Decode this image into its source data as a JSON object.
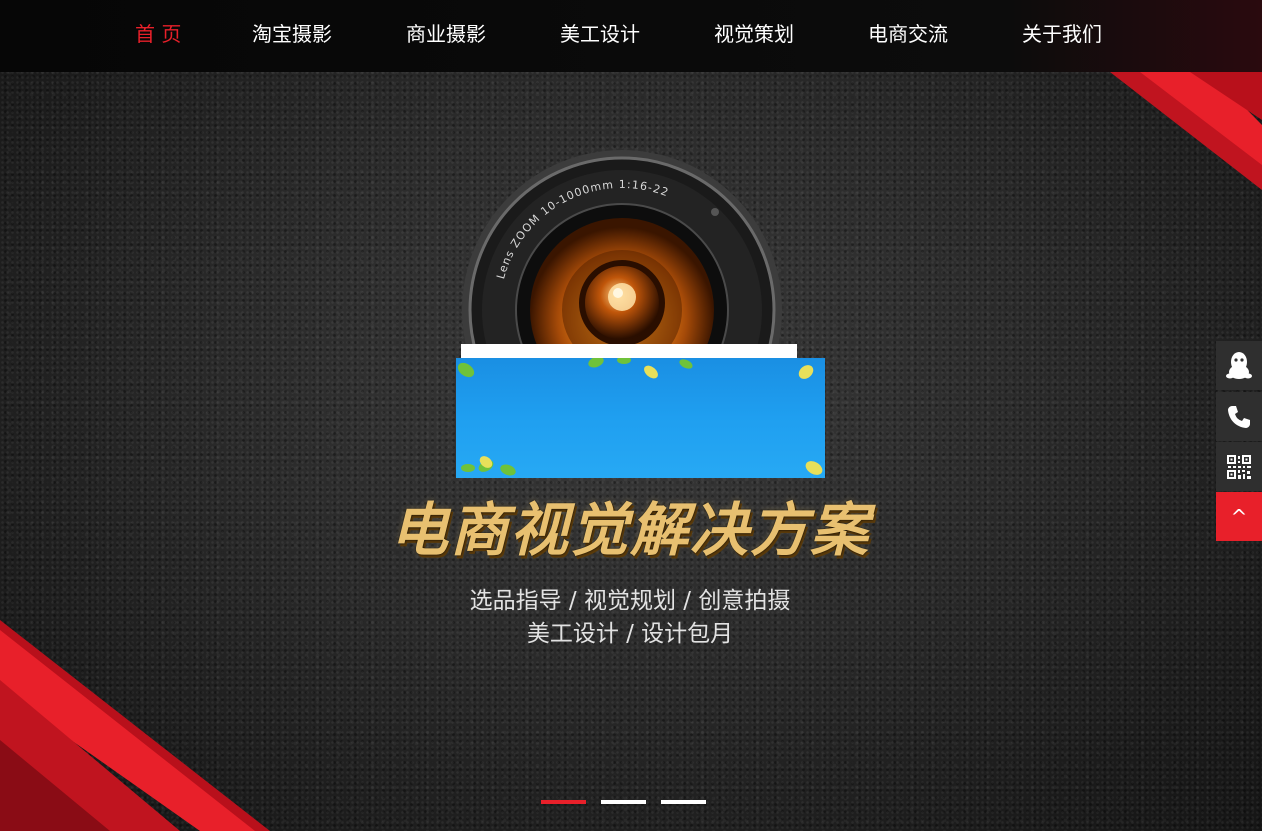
{
  "nav": {
    "items": [
      {
        "label": "首 页",
        "active": true
      },
      {
        "label": "淘宝摄影",
        "active": false
      },
      {
        "label": "商业摄影",
        "active": false
      },
      {
        "label": "美工设计",
        "active": false
      },
      {
        "label": "视觉策划",
        "active": false
      },
      {
        "label": "电商交流",
        "active": false
      },
      {
        "label": "关于我们",
        "active": false
      }
    ]
  },
  "hero": {
    "lens_ring_text": "Lens ZOOM 10-1000mm 1:16-22",
    "title": "电商视觉解决方案",
    "subtitle_line1": "选品指导 / 视觉规划 / 创意拍摄",
    "subtitle_line2": "美工设计 / 设计包月"
  },
  "slider": {
    "dot_count": 3,
    "active_index": 0
  },
  "toolbar": {
    "icons": [
      "qq-icon",
      "phone-icon",
      "qrcode-icon"
    ],
    "back_to_top_label": "^"
  },
  "colors": {
    "accent": "#e8202a",
    "nav_bg": "#0a0a0a",
    "banner_blue": "#1f9ff0",
    "title_gold": "#e8c070"
  }
}
